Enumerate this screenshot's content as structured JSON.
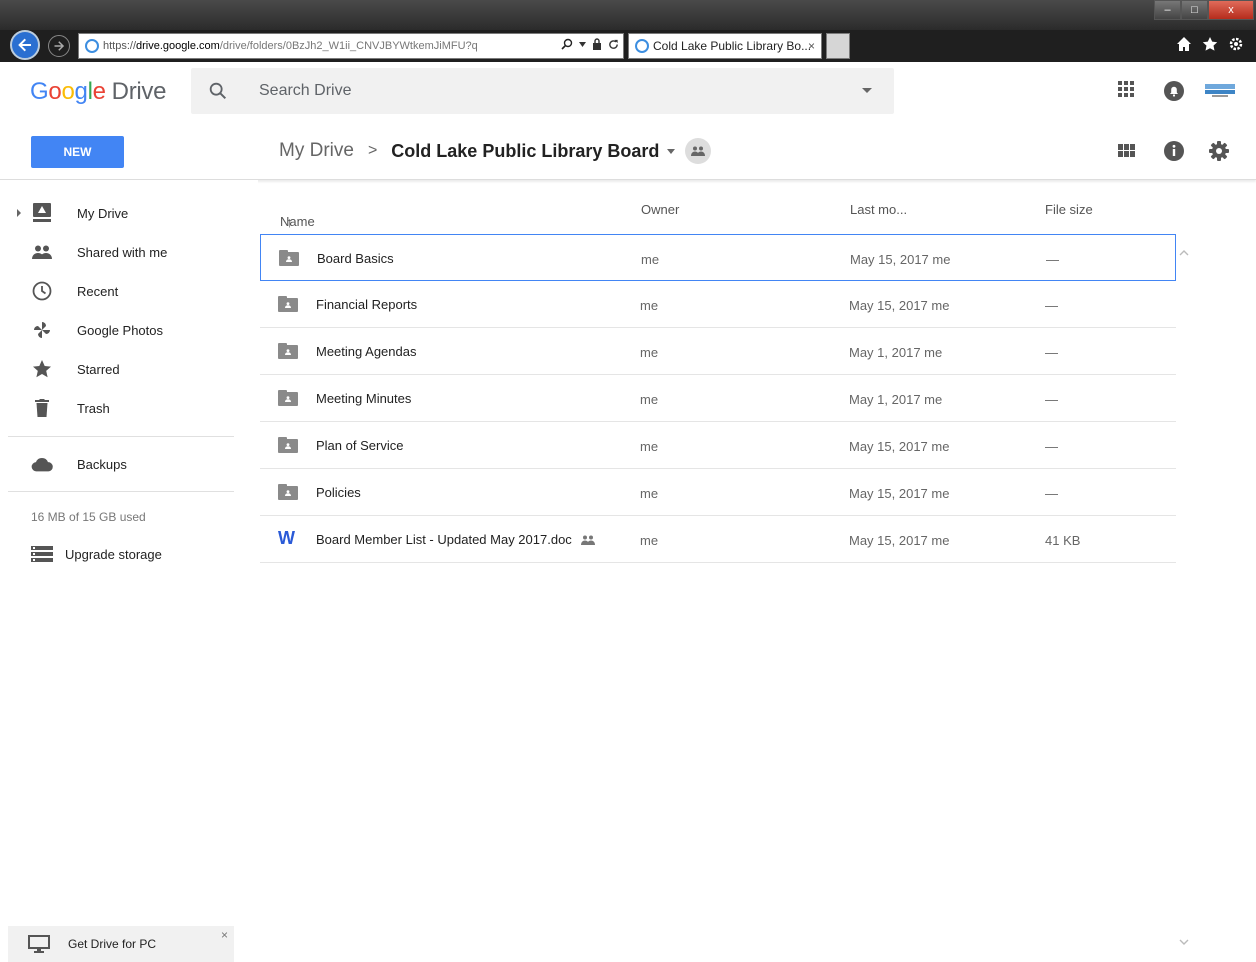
{
  "browser": {
    "url_scheme": "https://",
    "url_host": "drive.google.com",
    "url_path": "/drive/folders/0BzJh2_W1ii_CNVJBYWtkemJiMFU?q",
    "tab_title": "Cold Lake Public Library Bo...",
    "tab_close": "×",
    "win_minimize": "–",
    "win_restore": "□",
    "win_close": "x"
  },
  "header": {
    "logo_letters": [
      "G",
      "o",
      "o",
      "g",
      "l",
      "e"
    ],
    "product_name": "Drive",
    "search_placeholder": "Search Drive"
  },
  "toolbar": {
    "new_label": "NEW",
    "breadcrumb_root": "My Drive",
    "breadcrumb_sep": ">",
    "breadcrumb_current": "Cold Lake Public Library Board"
  },
  "sidebar": {
    "items": [
      {
        "label": "My Drive",
        "icon": "drive-icon"
      },
      {
        "label": "Shared with me",
        "icon": "shared-people-icon"
      },
      {
        "label": "Recent",
        "icon": "clock-icon"
      },
      {
        "label": "Google Photos",
        "icon": "photos-pinwheel-icon"
      },
      {
        "label": "Starred",
        "icon": "star-icon"
      },
      {
        "label": "Trash",
        "icon": "trash-icon"
      }
    ],
    "backups_label": "Backups",
    "storage_text": "16 MB of 15 GB used",
    "upgrade_label": "Upgrade storage",
    "get_drive_label": "Get Drive for PC",
    "get_drive_close": "×"
  },
  "list": {
    "columns": {
      "name": "Name",
      "owner": "Owner",
      "modified": "Last mo...",
      "size": "File size"
    },
    "sort_indicator": "↑",
    "rows": [
      {
        "name": "Board Basics",
        "type": "shared-folder",
        "owner": "me",
        "modified": "May 15, 2017 me",
        "size": "—"
      },
      {
        "name": "Financial Reports",
        "type": "shared-folder",
        "owner": "me",
        "modified": "May 15, 2017 me",
        "size": "—"
      },
      {
        "name": "Meeting Agendas",
        "type": "shared-folder",
        "owner": "me",
        "modified": "May 1, 2017 me",
        "size": "—"
      },
      {
        "name": "Meeting Minutes",
        "type": "shared-folder",
        "owner": "me",
        "modified": "May 1, 2017 me",
        "size": "—"
      },
      {
        "name": "Plan of Service",
        "type": "shared-folder",
        "owner": "me",
        "modified": "May 15, 2017 me",
        "size": "—"
      },
      {
        "name": "Policies",
        "type": "shared-folder",
        "owner": "me",
        "modified": "May 15, 2017 me",
        "size": "—"
      },
      {
        "name": "Board Member List - Updated May 2017.doc",
        "type": "word-doc",
        "owner": "me",
        "modified": "May 15, 2017 me",
        "size": "41 KB"
      }
    ],
    "word_glyph": "W"
  },
  "colors": {
    "accent": "#4285f4",
    "chrome": "#1f1f1f"
  }
}
